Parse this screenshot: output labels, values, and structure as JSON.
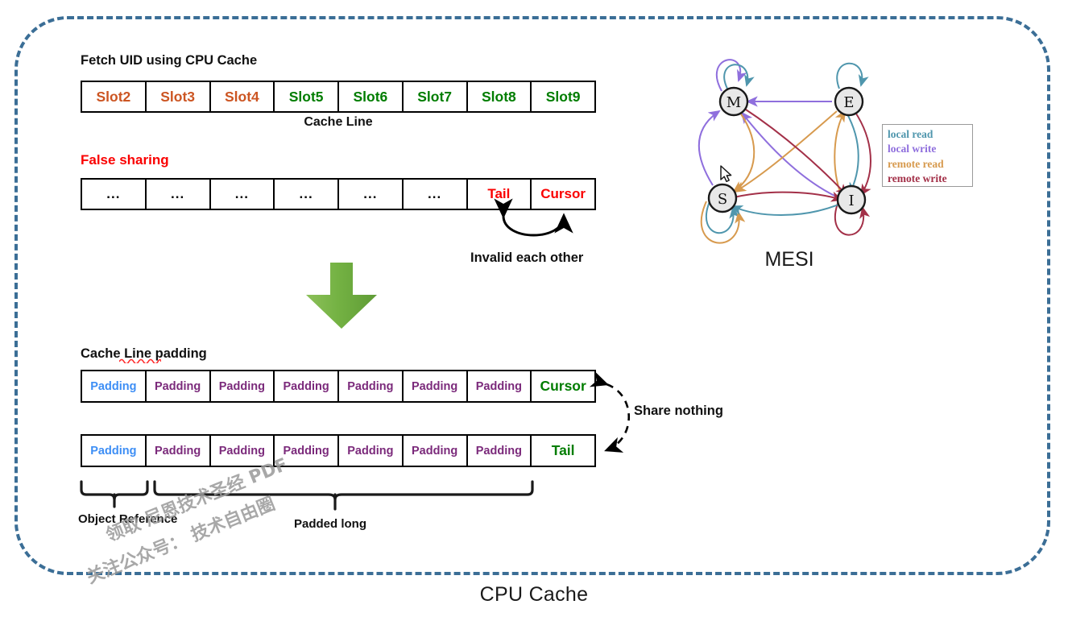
{
  "frame": {
    "title": "CPU Cache",
    "border_color": "#3b6e96"
  },
  "section_fetch": {
    "heading": "Fetch UID using CPU Cache",
    "caption": "Cache Line",
    "slots": [
      {
        "label": "Slot2",
        "color": "#cc5522"
      },
      {
        "label": "Slot3",
        "color": "#cc5522"
      },
      {
        "label": "Slot4",
        "color": "#cc5522"
      },
      {
        "label": "Slot5",
        "color": "#007d00"
      },
      {
        "label": "Slot6",
        "color": "#007d00"
      },
      {
        "label": "Slot7",
        "color": "#007d00"
      },
      {
        "label": "Slot8",
        "color": "#007d00"
      },
      {
        "label": "Slot9",
        "color": "#007d00"
      }
    ]
  },
  "section_false_sharing": {
    "heading": "False sharing",
    "heading_color": "#fa0000",
    "cells": [
      {
        "label": "...",
        "color": "#000000"
      },
      {
        "label": "...",
        "color": "#000000"
      },
      {
        "label": "...",
        "color": "#000000"
      },
      {
        "label": "...",
        "color": "#000000"
      },
      {
        "label": "...",
        "color": "#000000"
      },
      {
        "label": "...",
        "color": "#000000"
      },
      {
        "label": "Tail",
        "color": "#fa0000"
      },
      {
        "label": "Cursor",
        "color": "#fa0000"
      }
    ],
    "annotation": "Invalid each other"
  },
  "transition": {
    "arrow_color": "#6aaa3c"
  },
  "section_padding": {
    "heading": "Cache Line padding",
    "row1": [
      {
        "label": "Padding",
        "color": "#3d8ef5"
      },
      {
        "label": "Padding",
        "color": "#7b2a7b"
      },
      {
        "label": "Padding",
        "color": "#7b2a7b"
      },
      {
        "label": "Padding",
        "color": "#7b2a7b"
      },
      {
        "label": "Padding",
        "color": "#7b2a7b"
      },
      {
        "label": "Padding",
        "color": "#7b2a7b"
      },
      {
        "label": "Padding",
        "color": "#7b2a7b"
      },
      {
        "label": "Cursor",
        "color": "#007d00"
      }
    ],
    "row2": [
      {
        "label": "Padding",
        "color": "#3d8ef5"
      },
      {
        "label": "Padding",
        "color": "#7b2a7b"
      },
      {
        "label": "Padding",
        "color": "#7b2a7b"
      },
      {
        "label": "Padding",
        "color": "#7b2a7b"
      },
      {
        "label": "Padding",
        "color": "#7b2a7b"
      },
      {
        "label": "Padding",
        "color": "#7b2a7b"
      },
      {
        "label": "Padding",
        "color": "#7b2a7b"
      },
      {
        "label": "Tail",
        "color": "#007d00"
      }
    ],
    "annotation": "Share nothing",
    "brace_object_reference": "Object Reference",
    "brace_padded_long": "Padded long"
  },
  "mesi": {
    "title": "MESI",
    "nodes": [
      {
        "id": "M",
        "label": "M"
      },
      {
        "id": "E",
        "label": "E"
      },
      {
        "id": "S",
        "label": "S"
      },
      {
        "id": "I",
        "label": "I"
      }
    ],
    "legend": [
      {
        "label": "local read",
        "color": "#4f96ad"
      },
      {
        "label": "local write",
        "color": "#8f6fdd"
      },
      {
        "label": "remote read",
        "color": "#d79a4e"
      },
      {
        "label": "remote write",
        "color": "#a33048"
      }
    ]
  },
  "watermark": {
    "line1": "领取 尼恩技术圣经 PDF",
    "line2": "关注公众号： 技术自由圈"
  }
}
